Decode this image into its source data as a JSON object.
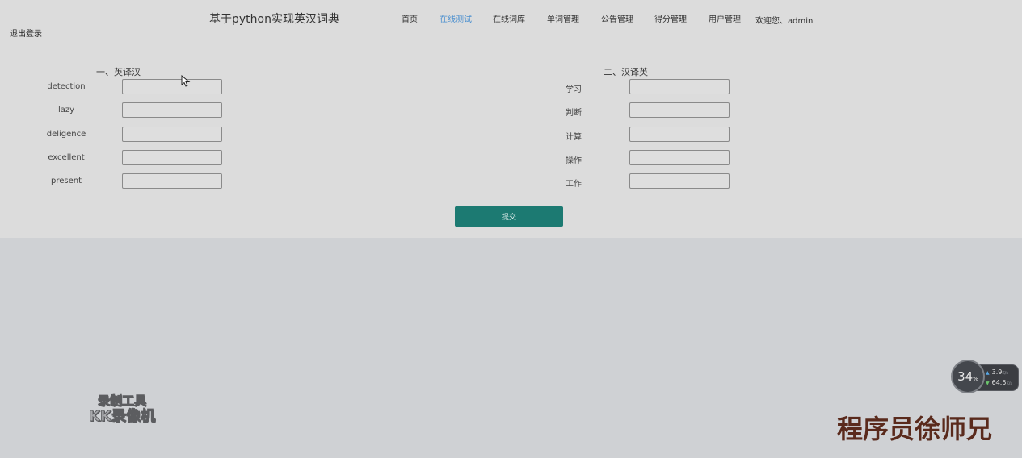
{
  "header": {
    "site_title": "基于python实现英汉词典",
    "nav": [
      {
        "label": "首页",
        "active": false
      },
      {
        "label": "在线测试",
        "active": true
      },
      {
        "label": "在线词库",
        "active": false
      },
      {
        "label": "单词管理",
        "active": false
      },
      {
        "label": "公告管理",
        "active": false
      },
      {
        "label": "得分管理",
        "active": false
      },
      {
        "label": "用户管理",
        "active": false
      }
    ],
    "welcome": "欢迎您、admin",
    "logout": "退出登录"
  },
  "quiz": {
    "en_to_zh": {
      "title": "一、英译汉",
      "words": [
        "detection",
        "lazy",
        "deligence",
        "excellent",
        "present"
      ]
    },
    "zh_to_en": {
      "title": "二、汉译英",
      "words": [
        "学习",
        "判断",
        "计算",
        "操作",
        "工作"
      ]
    },
    "submit_label": "提交"
  },
  "overlays": {
    "recorder_line1": "录制工具",
    "recorder_line2": "KK录像机",
    "author": "程序员徐师兄",
    "net_widget": {
      "percent": "34",
      "percent_unit": "%",
      "upload": "3.9",
      "upload_unit": "K/s",
      "download": "64.5",
      "download_unit": "K/s"
    }
  },
  "colors": {
    "page_bg": "#dcdcdc",
    "outer_bg": "#cfd1d4",
    "nav_active": "#4a8fcf",
    "submit_bg": "#1c7a72",
    "author_color": "#5a2a1c"
  }
}
